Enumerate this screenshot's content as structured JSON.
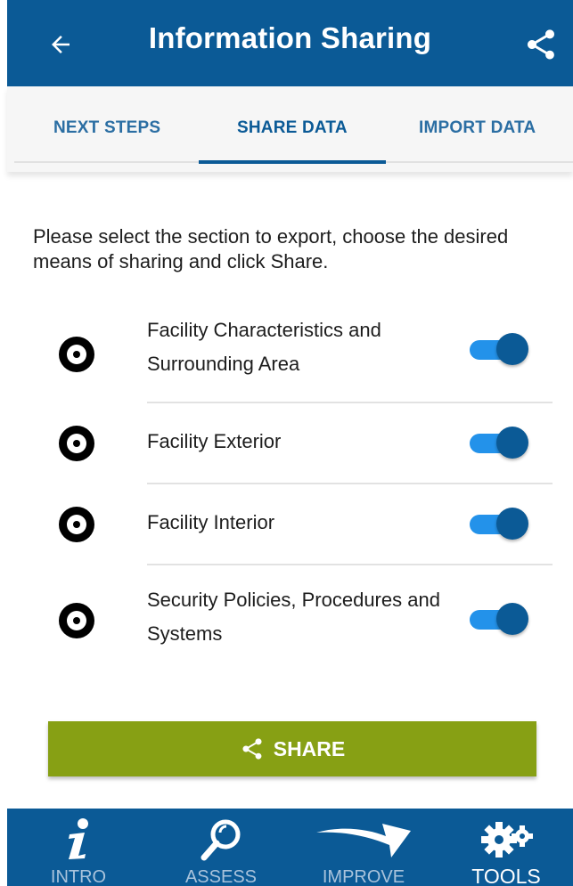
{
  "header": {
    "title": "Information Sharing",
    "back_icon": "arrow-left-icon",
    "share_icon": "share-icon"
  },
  "tabs": [
    {
      "label": "NEXT STEPS",
      "active": false
    },
    {
      "label": "SHARE DATA",
      "active": true
    },
    {
      "label": "IMPORT DATA",
      "active": false
    }
  ],
  "intro": "Please select the section to export, choose the desired means of sharing and click Share.",
  "sections": [
    {
      "label": "Facility Characteristics and Surrounding Area",
      "enabled": true
    },
    {
      "label": "Facility Exterior",
      "enabled": true
    },
    {
      "label": "Facility Interior",
      "enabled": true
    },
    {
      "label": "Security Policies, Procedures and Systems",
      "enabled": true
    }
  ],
  "share_button": {
    "label": "SHARE",
    "icon": "share-icon"
  },
  "bottom_nav": [
    {
      "label": "INTRO",
      "icon": "info-icon",
      "active": false
    },
    {
      "label": "ASSESS",
      "icon": "magnifier-icon",
      "active": false
    },
    {
      "label": "IMPROVE",
      "icon": "swoosh-arrow-icon",
      "active": false
    },
    {
      "label": "TOOLS",
      "icon": "gears-icon",
      "active": true
    }
  ],
  "colors": {
    "primary": "#0b5a96",
    "toggle_track": "#2392ea",
    "share_button": "#87a014",
    "tab_text": "#2b6ea3"
  }
}
